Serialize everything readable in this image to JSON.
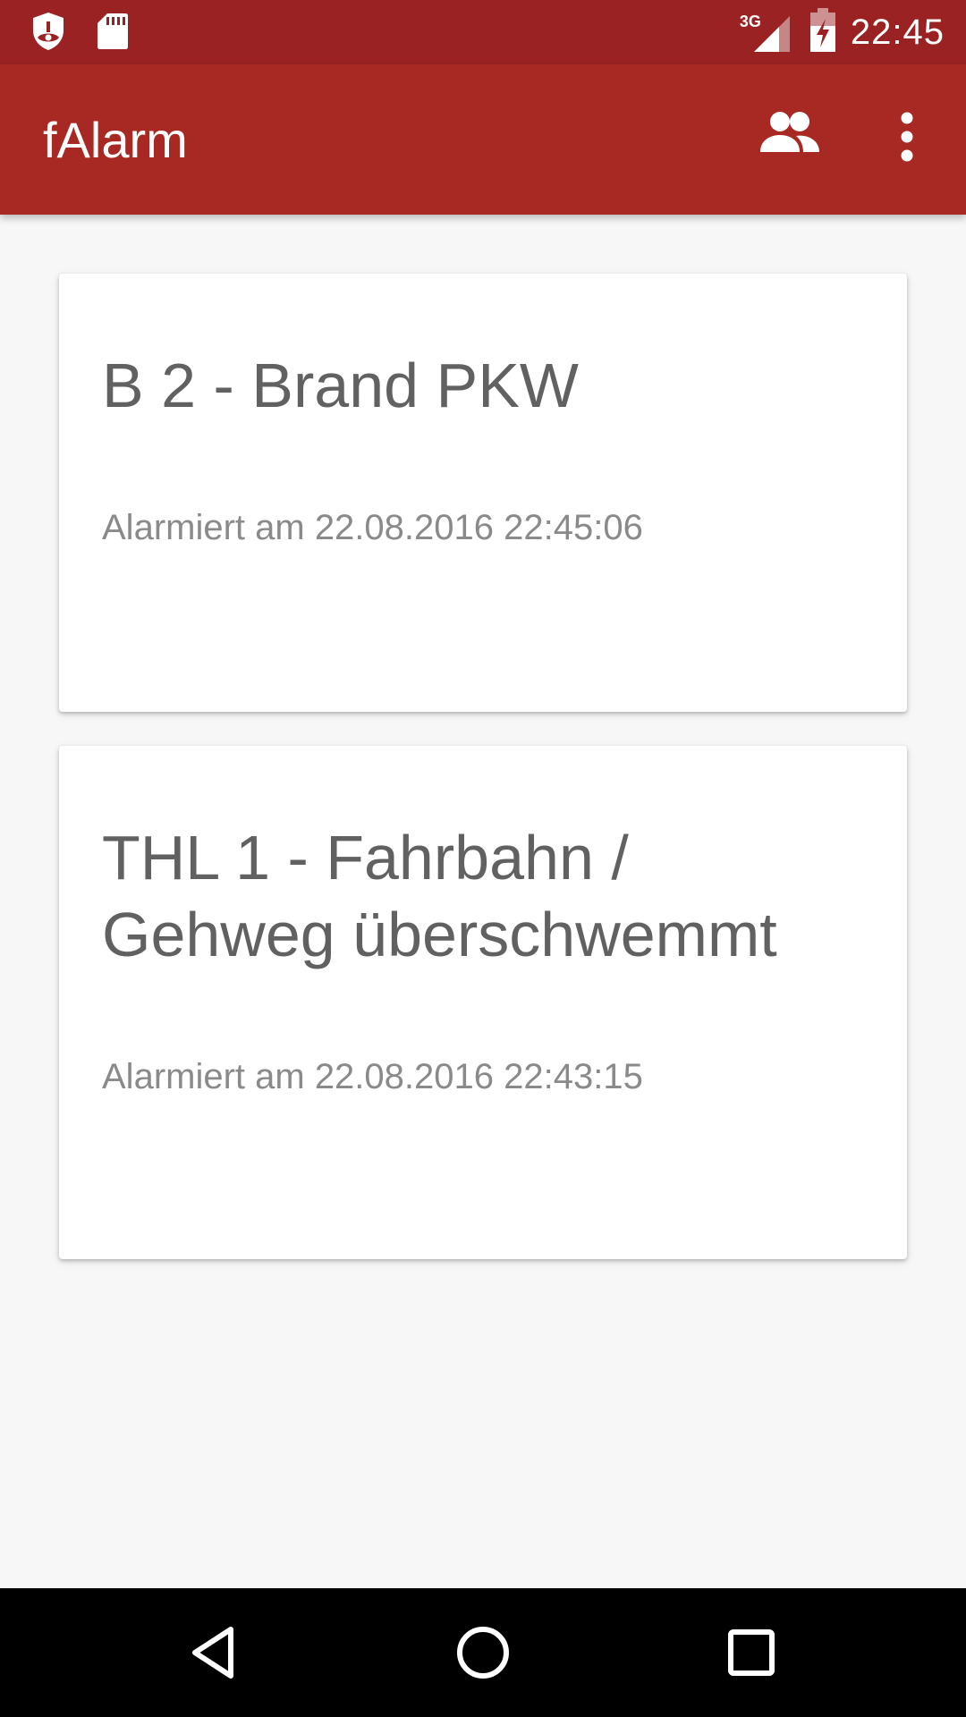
{
  "status_bar": {
    "time": "22:45",
    "network": "3G",
    "icons": [
      "shield-alert-icon",
      "sd-card-icon",
      "signal-icon",
      "battery-charging-icon"
    ]
  },
  "app_bar": {
    "title": "fAlarm",
    "actions": [
      "people-icon",
      "more-vert-icon"
    ]
  },
  "alarms": [
    {
      "title": "B 2 - Brand PKW",
      "time_text": "Alarmiert am 22.08.2016 22:45:06"
    },
    {
      "title": "THL 1 - Fahrbahn / Gehweg überschwemmt",
      "time_text": "Alarmiert am 22.08.2016 22:43:15"
    }
  ],
  "nav_bar": {
    "buttons": [
      "back-icon",
      "home-icon",
      "recents-icon"
    ]
  },
  "colors": {
    "status_bar": "#9a2222",
    "app_bar": "#a82823",
    "background": "#f7f7f7",
    "card": "#ffffff",
    "title_text": "#616161",
    "secondary_text": "#8a8a8a"
  }
}
